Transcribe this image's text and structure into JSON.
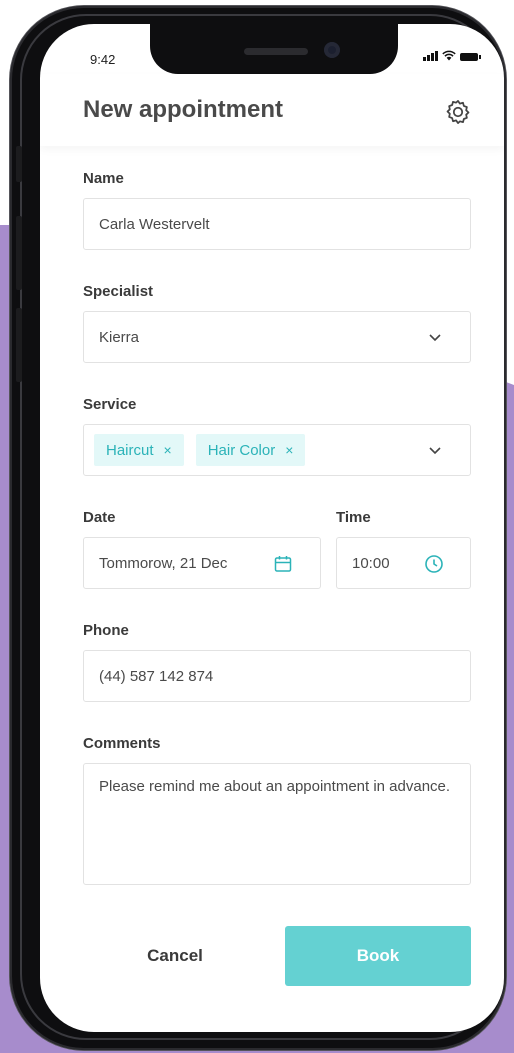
{
  "status": {
    "time": "9:42"
  },
  "header": {
    "title": "New appointment",
    "settings_icon": "gear-icon"
  },
  "form": {
    "name": {
      "label": "Name",
      "value": "Carla Westervelt"
    },
    "specialist": {
      "label": "Specialist",
      "value": "Kierra"
    },
    "service": {
      "label": "Service",
      "chips": [
        "Haircut",
        "Hair Color"
      ],
      "remove_glyph": "×"
    },
    "date": {
      "label": "Date",
      "value": "Tommorow, 21 Dec",
      "icon": "calendar-icon"
    },
    "time": {
      "label": "Time",
      "value": "10:00",
      "icon": "clock-icon"
    },
    "phone": {
      "label": "Phone",
      "value": "(44) 587 142 874"
    },
    "comments": {
      "label": "Comments",
      "value": "Please remind me about an appointment in advance."
    }
  },
  "actions": {
    "cancel_label": "Cancel",
    "book_label": "Book"
  },
  "colors": {
    "accent": "#64d1d2",
    "chip_bg": "#e3f8f8",
    "chip_text": "#2bb3b8",
    "background": "#a78ccc"
  }
}
